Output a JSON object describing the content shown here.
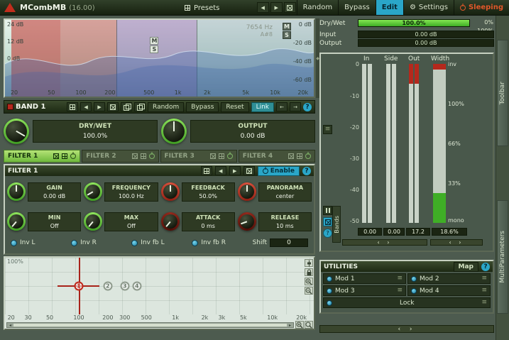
{
  "titlebar": {
    "title": "MCombMB",
    "version": "(16.00)",
    "presets": "Presets",
    "random": "Random",
    "bypass": "Bypass",
    "edit": "Edit",
    "settings": "Settings",
    "sleeping": "Sleeping"
  },
  "spectrum": {
    "db_left": [
      "24 dB",
      "12 dB",
      "0 dB"
    ],
    "db_right": [
      "0 dB",
      "-20 dB",
      "-40 dB",
      "-60 dB"
    ],
    "freqs": [
      "20",
      "50",
      "100",
      "200",
      "500",
      "1k",
      "2k",
      "5k",
      "10k",
      "20k"
    ],
    "readout_freq": "7654 Hz",
    "readout_note": "A#8",
    "mid": "M",
    "side": "S"
  },
  "band": {
    "name": "BAND 1",
    "random": "Random",
    "bypass": "Bypass",
    "reset": "Reset",
    "link": "Link",
    "help": "?",
    "drywet_label": "DRY/WET",
    "drywet_value": "100.0%",
    "output_label": "OUTPUT",
    "output_value": "0.00 dB"
  },
  "filters": {
    "tabs": [
      "FILTER 1",
      "FILTER 2",
      "FILTER 3",
      "FILTER 4"
    ],
    "panel_title": "FILTER 1",
    "enable": "Enable",
    "help": "?",
    "knobs": [
      {
        "label": "GAIN",
        "value": "0.00 dB"
      },
      {
        "label": "FREQUENCY",
        "value": "100.0 Hz"
      },
      {
        "label": "FEEDBACK",
        "value": "50.0%"
      },
      {
        "label": "PANORAMA",
        "value": "center"
      },
      {
        "label": "MIN",
        "value": "Off"
      },
      {
        "label": "MAX",
        "value": "Off"
      },
      {
        "label": "ATTACK",
        "value": "0 ms"
      },
      {
        "label": "RELEASE",
        "value": "10 ms"
      }
    ],
    "checks": [
      "Inv L",
      "Inv R",
      "Inv fb L",
      "Inv fb R"
    ],
    "shift_label": "Shift",
    "shift_value": "0"
  },
  "graph": {
    "y_max": "100%",
    "x_labels": [
      "20",
      "30",
      "50",
      "100",
      "200",
      "300",
      "500",
      "1k",
      "2k",
      "3k",
      "5k",
      "10k",
      "20k"
    ],
    "markers": [
      "1",
      "2",
      "3",
      "4"
    ]
  },
  "right": {
    "drywet_label": "Dry/Wet",
    "drywet_value": "100.0%",
    "range_min": "0%",
    "range_max": "100%",
    "input_label": "Input",
    "input_value": "0.00 dB",
    "output_label": "Output",
    "output_value": "0.00 dB"
  },
  "meters": {
    "cols": [
      "In",
      "Side",
      "Out",
      "Width"
    ],
    "scale": [
      "0",
      "-10",
      "-20",
      "-30",
      "-40",
      "-50"
    ],
    "width_scale": [
      "inv",
      "100%",
      "66%",
      "33%",
      "mono"
    ],
    "values": [
      "0.00",
      "0.00",
      "17.2",
      "18.6%"
    ],
    "bands": "Bands"
  },
  "utilities": {
    "title": "UTILITIES",
    "map": "Map",
    "help": "?",
    "mods": [
      "Mod 1",
      "Mod 2",
      "Mod 3",
      "Mod 4"
    ],
    "lock": "Lock"
  },
  "strip": {
    "toolbar": "Toolbar",
    "multiparameters": "MultiParameters"
  },
  "colors": {
    "accent_green": "#6ecb3c",
    "accent_cyan": "#2aa6c8",
    "accent_red": "#b5281c",
    "sleeping_text": "#e0582a"
  }
}
